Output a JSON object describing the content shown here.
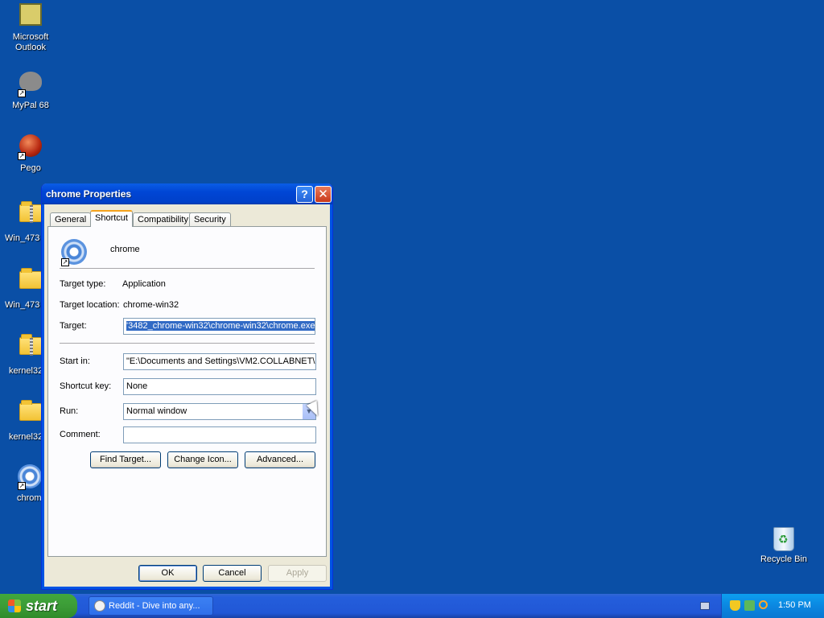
{
  "desktop": {
    "icons": [
      {
        "label": "Microsoft Outlook"
      },
      {
        "label": "MyPal 68"
      },
      {
        "label": "Pego"
      },
      {
        "label": "Win_473"
      },
      {
        "label": "Win_473"
      },
      {
        "label": "kernel32"
      },
      {
        "label": "kernel32"
      },
      {
        "label": "chrom"
      }
    ],
    "recycle_bin": {
      "label": "Recycle Bin"
    }
  },
  "window": {
    "title": "chrome Properties",
    "tabs": [
      {
        "label": "General"
      },
      {
        "label": "Shortcut"
      },
      {
        "label": "Compatibility"
      },
      {
        "label": "Security"
      }
    ],
    "active_tab": "Shortcut",
    "shortcut": {
      "name": "chrome",
      "target_type_label": "Target type:",
      "target_type_value": "Application",
      "target_location_label": "Target location:",
      "target_location_value": "chrome-win32",
      "target_label": "Target:",
      "target_value": "'3482_chrome-win32\\chrome-win32\\chrome.exe\"",
      "start_in_label": "Start in:",
      "start_in_value": "\"E:\\Documents and Settings\\VM2.COLLABNET\\",
      "shortcut_key_label": "Shortcut key:",
      "shortcut_key_value": "None",
      "run_label": "Run:",
      "run_value": "Normal window",
      "comment_label": "Comment:",
      "comment_value": "",
      "find_target_label": "Find Target...",
      "change_icon_label": "Change Icon...",
      "advanced_label": "Advanced..."
    },
    "buttons": {
      "ok": "OK",
      "cancel": "Cancel",
      "apply": "Apply"
    }
  },
  "taskbar": {
    "start_label": "start",
    "items": [
      {
        "label": "Reddit - Dive into any..."
      }
    ],
    "clock": "1:50 PM"
  }
}
